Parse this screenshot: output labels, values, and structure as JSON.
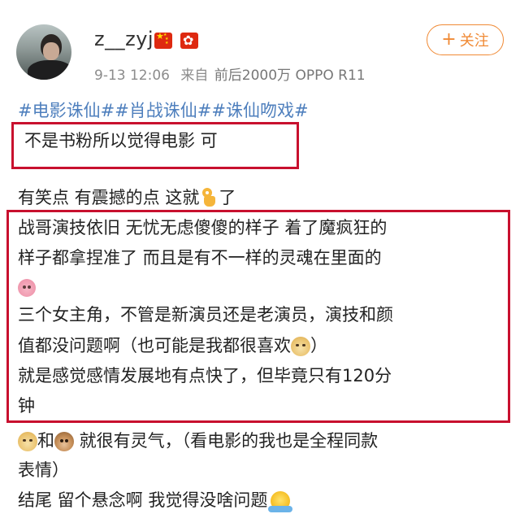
{
  "post": {
    "username": "z__zyj",
    "date": "9-13 12:06",
    "source_label": "来自",
    "source_device": "前后2000万 OPPO R11",
    "follow_label": "关注",
    "follow_plus": "+",
    "hashtags": [
      "#电影诛仙#",
      "#肖战诛仙#",
      "#诛仙吻戏#"
    ],
    "lines": {
      "l1": "不是书粉所以觉得电影  可",
      "l2_a": "有笑点 有震撼的点 这就",
      "l2_b": "了",
      "l3": "战哥演技依旧  无忧无虑傻傻的样子  着了魔疯狂的",
      "l4": "样子都拿捏准了  而且是有不一样的灵魂在里面的",
      "l6": "三个女主角，不管是新演员还是老演员，演技和颜",
      "l7_a": "值都没问题啊（也可能是我都很喜欢",
      "l7_b": "）",
      "l8": "就是感觉感情发展地有点快了，但毕竟只有120分",
      "l9": "钟",
      "l10_a": "和",
      "l10_b": " 就很有灵气，（看电影的我也是全程同款",
      "l11": "表情）",
      "l12": "结尾  留个悬念啊  我觉得没啥问题"
    },
    "emoji_icons": [
      "ok-hand-icon",
      "pink-bird-icon",
      "doge-icon",
      "monkey-icon",
      "shrug-icon"
    ]
  },
  "colors": {
    "hashtag": "#4e7fbd",
    "follow": "#f08a35",
    "highlight_box": "#c8102e",
    "meta_text": "#8c8c8c"
  }
}
